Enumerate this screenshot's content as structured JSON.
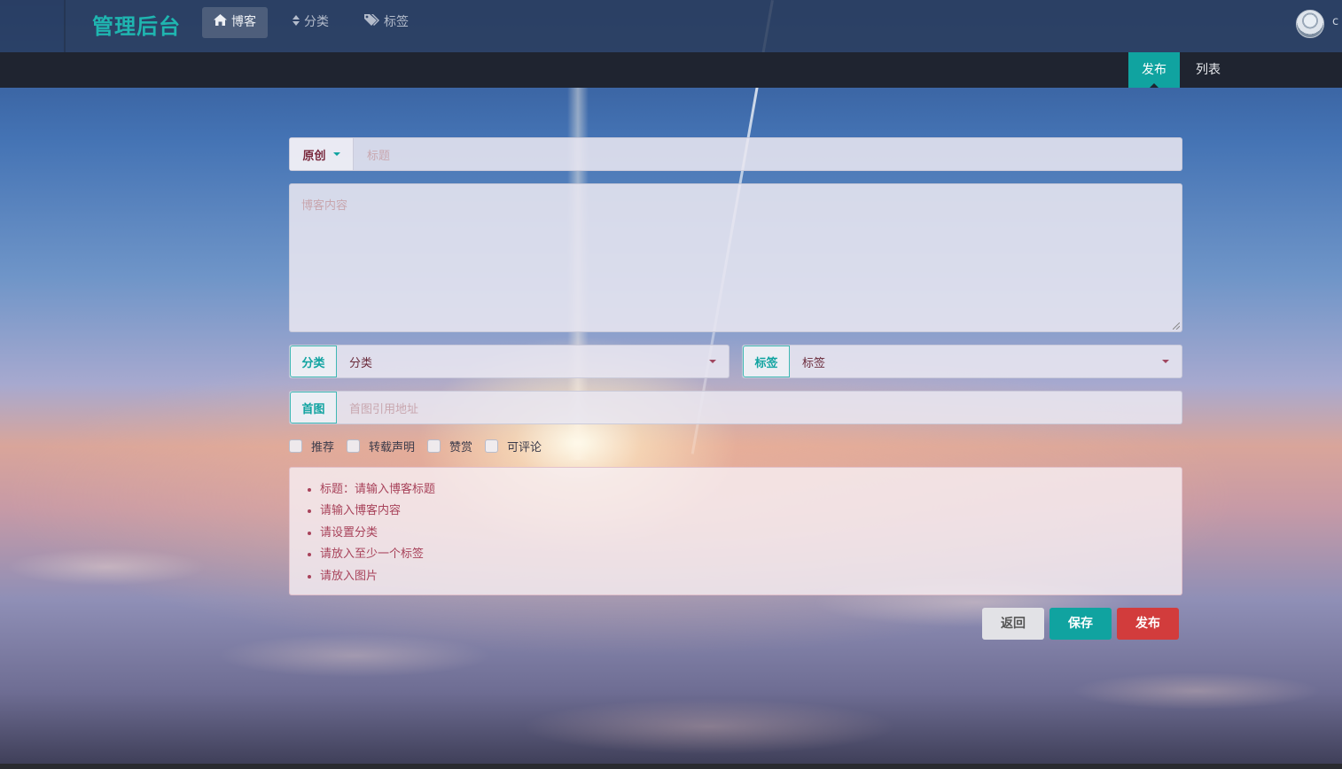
{
  "header": {
    "brand": "管理后台",
    "nav": [
      {
        "label": "博客",
        "icon": "home-icon",
        "active": true
      },
      {
        "label": "分类",
        "icon": "sort-icon",
        "active": false
      },
      {
        "label": "标签",
        "icon": "tags-icon",
        "active": false
      }
    ],
    "username_partial": "c"
  },
  "subnav": {
    "tabs": [
      {
        "label": "发布",
        "active": true
      },
      {
        "label": "列表",
        "active": false
      }
    ]
  },
  "form": {
    "type_dropdown": {
      "selected": "原创"
    },
    "title": {
      "placeholder": "标题"
    },
    "content": {
      "placeholder": "博客内容"
    },
    "category": {
      "label": "分类",
      "selected": "分类"
    },
    "tag": {
      "label": "标签",
      "selected": "标签"
    },
    "cover": {
      "label": "首图",
      "placeholder": "首图引用地址"
    },
    "checkboxes": [
      {
        "label": "推荐",
        "checked": false
      },
      {
        "label": "转载声明",
        "checked": false
      },
      {
        "label": "赞赏",
        "checked": false
      },
      {
        "label": "可评论",
        "checked": false
      }
    ],
    "errors": [
      "标题：请输入博客标题",
      "请输入博客内容",
      "请设置分类",
      "请放入至少一个标签",
      "请放入图片"
    ],
    "buttons": {
      "back": "返回",
      "save": "保存",
      "publish": "发布"
    }
  },
  "colors": {
    "accent": "#10a3a0",
    "danger": "#d23c3c",
    "brand": "#1fb5b0"
  }
}
